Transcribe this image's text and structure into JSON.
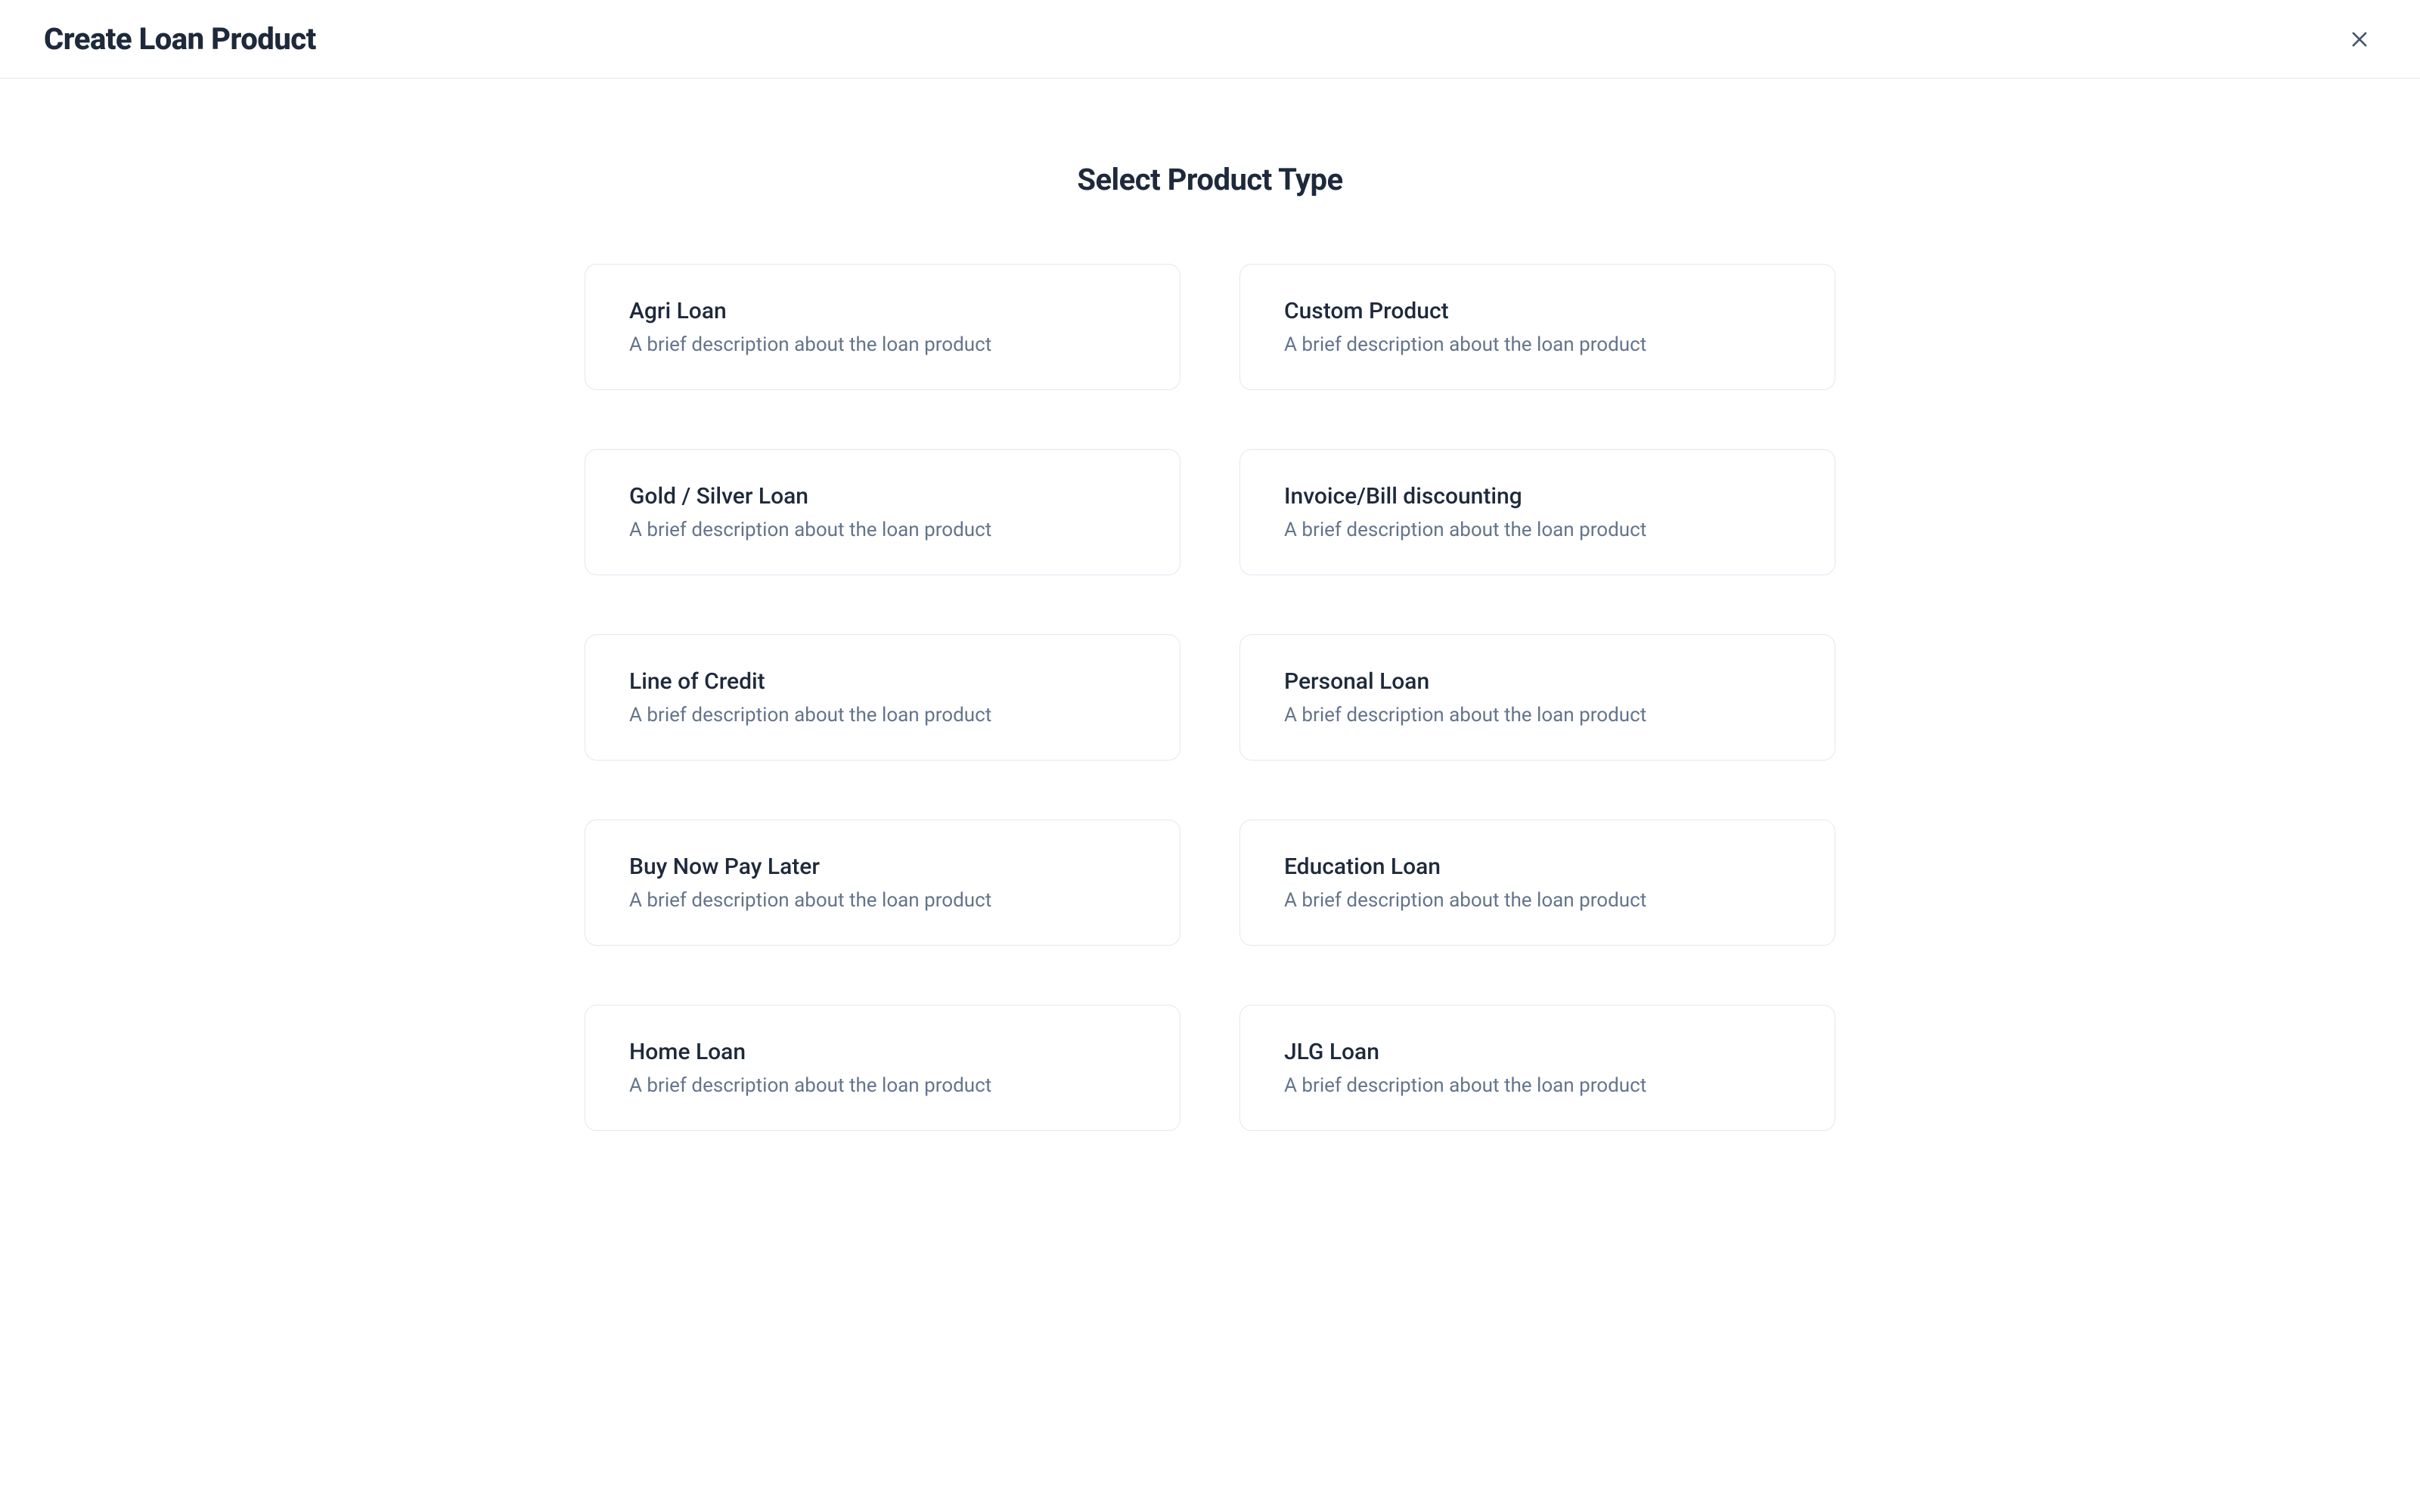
{
  "header": {
    "title": "Create Loan Product"
  },
  "section": {
    "title": "Select Product Type"
  },
  "products": [
    {
      "title": "Agri Loan",
      "description": "A brief description about the loan product"
    },
    {
      "title": "Custom Product",
      "description": "A brief description about the loan product"
    },
    {
      "title": "Gold / Silver Loan",
      "description": "A brief description about the loan product"
    },
    {
      "title": "Invoice/Bill discounting",
      "description": "A brief description about the loan product"
    },
    {
      "title": "Line of Credit",
      "description": "A brief description about the loan product"
    },
    {
      "title": "Personal Loan",
      "description": "A brief description about the loan product"
    },
    {
      "title": "Buy Now Pay Later",
      "description": "A brief description about the loan product"
    },
    {
      "title": "Education Loan",
      "description": "A brief description about the loan product"
    },
    {
      "title": "Home Loan",
      "description": "A brief description about the loan product"
    },
    {
      "title": "JLG Loan",
      "description": "A brief description about the loan product"
    }
  ]
}
